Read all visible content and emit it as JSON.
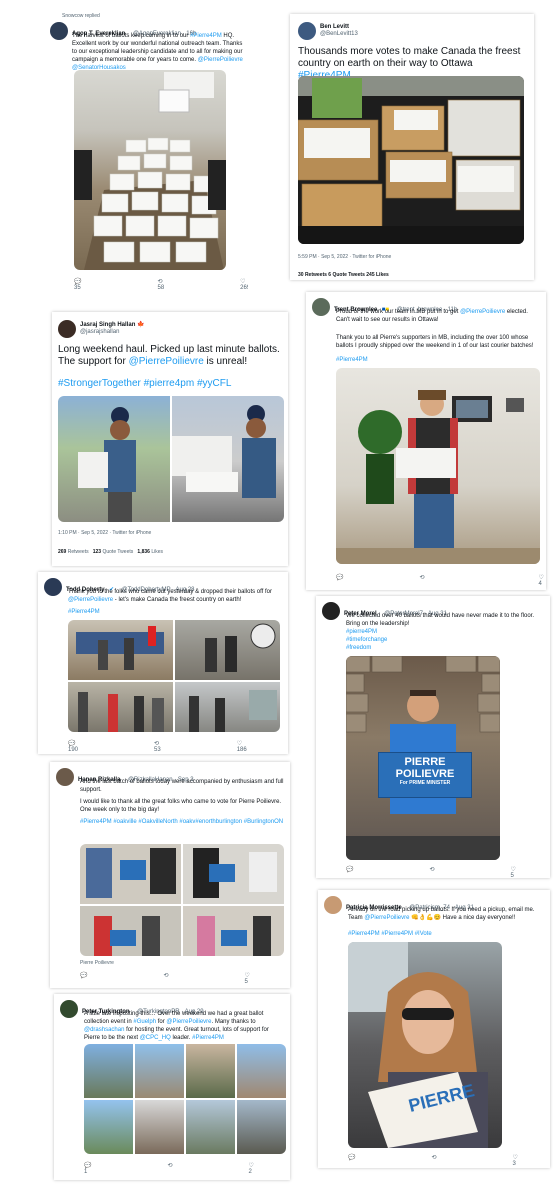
{
  "t1": {
    "replied": "Snowcow replied",
    "name": "Agop T. Evereklian",
    "handle": "@AgopEvereklian · 16h",
    "text_a": "The harvest of ballots keep coming in to our ",
    "tag": "#Pierre4PM",
    "text_b": " HQ. Excellent work by our wonderful national outreach team. Thanks to our exceptional leadership candidate and to all for making our campaign a memorable one for years to come. ",
    "mentions": "@PierrePoilievre @SenatorHousakos",
    "replies": "35",
    "retweets": "58",
    "likes": "269"
  },
  "t2": {
    "name": "Ben Levitt",
    "handle": "@BenLevitt13",
    "text_a": "Thousands more votes to make Canada the freest country on earth on their way to Ottawa ",
    "tag": "#Pierre4PM",
    "time": "5:59 PM · Sep 5, 2022 · Twitter for iPhone",
    "stats": "30 Retweets   6 Quote Tweets   245 Likes"
  },
  "t3": {
    "name": "Jasraj Singh Hallan",
    "handle": "@jasrajshallan",
    "text_a": "Long weekend haul. Picked up last minute ballots. The support for ",
    "mention": "@PierrePoilievre",
    "text_b": " is unreal!",
    "tags": "#StrongerTogether #pierre4pm #yyCFL",
    "time": "1:10 PM · Sep 5, 2022 · Twitter for iPhone",
    "stats_rt": "269",
    "stats_rt_label": "Retweets",
    "stats_q": "123",
    "stats_q_label": "Quote Tweets",
    "stats_l": "1,836",
    "stats_l_label": "Likes"
  },
  "t4": {
    "name": "Trent Brownlee",
    "handle": "@trent_brownlee · 11h",
    "text_a": "Proud of the work our team in MB put in to get ",
    "mention": "@PierrePoilievre",
    "text_b": " elected. Can't wait to see our results in Ottawa!",
    "text_c": "Thank you to all Pierre's supporters in MB, including the over 100 whose ballots I proudly shipped over the weekend in 1 of our last courier batches!",
    "tag": "#Pierre4PM",
    "retweets": "",
    "likes": "4"
  },
  "t5": {
    "name": "Todd Doherty",
    "handle": "@ToddDohertyMP · Aug 28",
    "text_a": "Thank you to the folks who came out yesterday & dropped their ballots off for ",
    "mention": "@PierrePoilievre",
    "text_b": " - let's make Canada the freest country on earth!",
    "tag": "#Pierre4PM",
    "replies": "190",
    "retweets": "53",
    "likes": "186"
  },
  "t6": {
    "name": "Peter Morel",
    "handle": "@PeterMorel7 · Aug 31",
    "text_a": "We collected over 40 ballots that would have never made it to the floor. Bring on the leadership!",
    "tags": [
      "#pierre4PM",
      "#timeforchange",
      "#freedom"
    ],
    "sign_line1": "PIERRE",
    "sign_line2": "POILIEVRE",
    "sign_for": "For",
    "sign_pm": "PRIME MINISTER",
    "likes": "5"
  },
  "t7": {
    "name": "Hanan Rizkalla",
    "handle": "@RizkallaHanan · Sep 3",
    "text_a": "And the last batch of ballots today were accompanied by enthusiasm and full support.",
    "text_b": "I would like to thank all the great folks who came to vote for Pierre Poilievre. One week only to the big day!",
    "tags": "#Pierre4PM #oakville #OakvilleNorth #oakv#enorthburlington #BurlingtonON",
    "caption": "Pierre Poilievre",
    "likes": "5"
  },
  "t8": {
    "name": "Patricia Morrissette",
    "handle": "@Patricism_74 · Aug 31",
    "text_a": "Already on the road picking up ballots. If you need a pickup, email me. Team ",
    "mention": "@PierrePoilievre",
    "text_b": " 👊👌💪😊 Have a nice day everyone!!",
    "tags": "#Pierre4PM #Pierre4PM #IVote",
    "sign_line1": "PIERRE",
    "likes": "3"
  },
  "t9": {
    "name": "Peter Turkington",
    "handle": "@TurkingtonPR · Aug 29",
    "text_a": "A little late in posting this… Over the weekend we had a great ballot collection event in ",
    "mention1": "#Guelph",
    "text_b": " for ",
    "mention2": "@PierrePoilievre",
    "text_c": ". Many thanks to ",
    "mention3": "@drashsachan",
    "text_d": " for hosting the event. Great turnout, lots of support for Pierre to be the next ",
    "mention4": "@CPC_HQ",
    "text_e": " leader. ",
    "tag": "#Pierre4PM",
    "replies": "1",
    "likes": "2"
  },
  "colors": {
    "link": "#1d9bf0",
    "sign_blue": "#2a6fb8",
    "text": "#0f1419",
    "muted": "#536471"
  },
  "icons": [
    "reply-icon",
    "retweet-icon",
    "like-icon",
    "verified-icon",
    "canada-flag-icon",
    "ukraine-flag-icon"
  ]
}
